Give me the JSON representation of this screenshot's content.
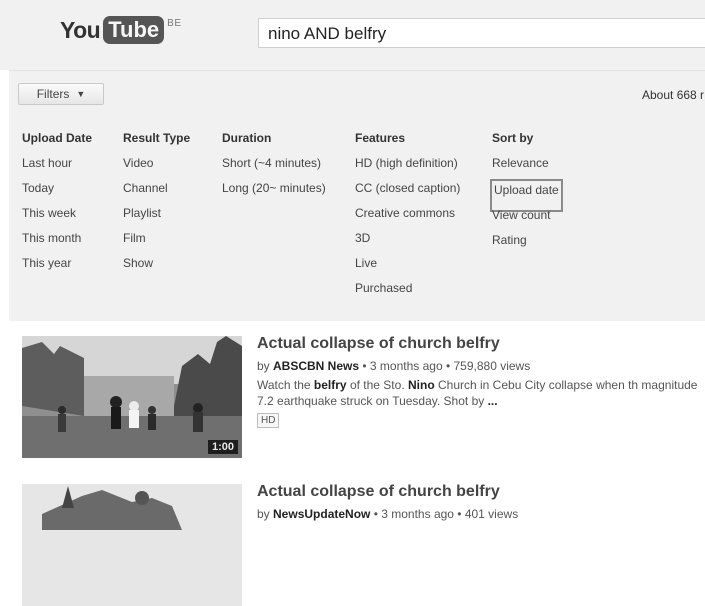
{
  "header": {
    "logo_you": "You",
    "logo_tube": "Tube",
    "logo_region": "BE",
    "search_value": "nino AND belfry"
  },
  "toolbar": {
    "filters_label": "Filters",
    "results_count": "About 668 r"
  },
  "filters": {
    "upload_date": {
      "title": "Upload Date",
      "options": [
        "Last hour",
        "Today",
        "This week",
        "This month",
        "This year"
      ]
    },
    "result_type": {
      "title": "Result Type",
      "options": [
        "Video",
        "Channel",
        "Playlist",
        "Film",
        "Show"
      ]
    },
    "duration": {
      "title": "Duration",
      "options": [
        "Short (~4 minutes)",
        "Long (20~ minutes)"
      ]
    },
    "features": {
      "title": "Features",
      "options": [
        "HD (high definition)",
        "CC (closed caption)",
        "Creative commons",
        "3D",
        "Live",
        "Purchased"
      ]
    },
    "sort_by": {
      "title": "Sort by",
      "options": [
        "Relevance",
        "Upload date",
        "View count",
        "Rating"
      ],
      "selected": "Upload date"
    }
  },
  "videos": [
    {
      "title": "Actual collapse of church belfry",
      "by_prefix": "by ",
      "channel": "ABSCBN News",
      "age": " • 3 months ago • 759,880 views",
      "desc_1": "Watch the ",
      "desc_kw1": "belfry",
      "desc_2": " of the Sto. ",
      "desc_kw2": "Nino",
      "desc_3": " Church in Cebu City collapse when th magnitude 7.2 earthquake struck on Tuesday. Shot by ",
      "desc_kw3": "...",
      "badge": "HD",
      "duration": "1:00"
    },
    {
      "title": "Actual collapse of church belfry",
      "by_prefix": "by ",
      "channel": "NewsUpdateNow",
      "age": " • 3 months ago • 401 views"
    }
  ],
  "colors": {
    "header_bg": "#f1f1f1",
    "panel_bg": "#f1f1f1",
    "selected_outline": "#8a8a8a"
  }
}
